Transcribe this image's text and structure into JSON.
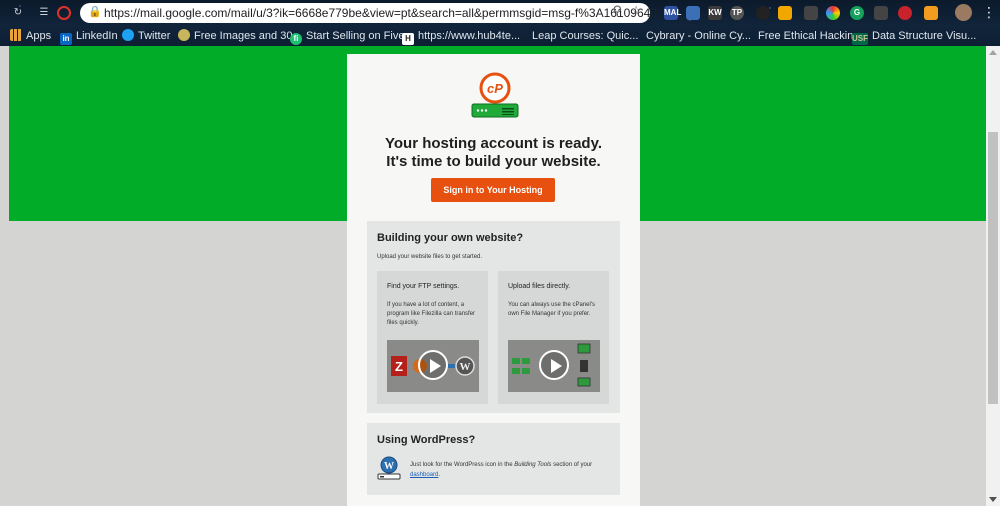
{
  "browser": {
    "url": "https://mail.google.com/mail/u/3?ik=6668e779be&view=pt&search=all&permmsgid=msg-f%3A16109640...",
    "nav_icons": [
      "reload-icon",
      "extension-icon",
      "opera-icon"
    ],
    "extensions": [
      "MAL",
      "KW",
      "G",
      "TP"
    ]
  },
  "bookmarks": [
    {
      "label": "Apps",
      "icon": "apps-grid-icon"
    },
    {
      "label": "LinkedIn",
      "icon": "linkedin-icon"
    },
    {
      "label": "Twitter",
      "icon": "twitter-icon"
    },
    {
      "label": "Free Images and 30...",
      "icon": "image-site-icon"
    },
    {
      "label": "Start Selling on Fiverr",
      "icon": "fiverr-icon"
    },
    {
      "label": "https://www.hub4te...",
      "icon": "hub-icon"
    },
    {
      "label": "Leap Courses: Quic...",
      "icon": "globe-icon"
    },
    {
      "label": "Cybrary - Online Cy...",
      "icon": "globe-icon"
    },
    {
      "label": "Free Ethical Hackin...",
      "icon": "globe-icon"
    },
    {
      "label": "Data Structure Visu...",
      "icon": "usf-icon"
    }
  ],
  "email": {
    "headline_line1": "Your hosting account is ready.",
    "headline_line2": "It's time to build your website.",
    "cta_label": "Sign in to Your Hosting",
    "build": {
      "title": "Building your own website?",
      "subtitle": "Upload your website files to get started.",
      "ftp": {
        "title": "Find your FTP settings.",
        "body": "If you have a lot of content, a program like Filezilla can transfer files quickly."
      },
      "upload": {
        "title": "Upload files directly.",
        "body": "You can always use the cPanel's own File Manager if you prefer."
      }
    },
    "wordpress": {
      "title": "Using WordPress?",
      "text_before": "Just look for the WordPress icon in the ",
      "text_italic": "Building Tools",
      "text_after": " section of your ",
      "link": "dashboard",
      "text_end": "."
    }
  },
  "colors": {
    "green_band": "#00ac28",
    "cta": "#e8500f",
    "cpanel_orange": "#e8500f",
    "server_green": "#1faa3a"
  }
}
